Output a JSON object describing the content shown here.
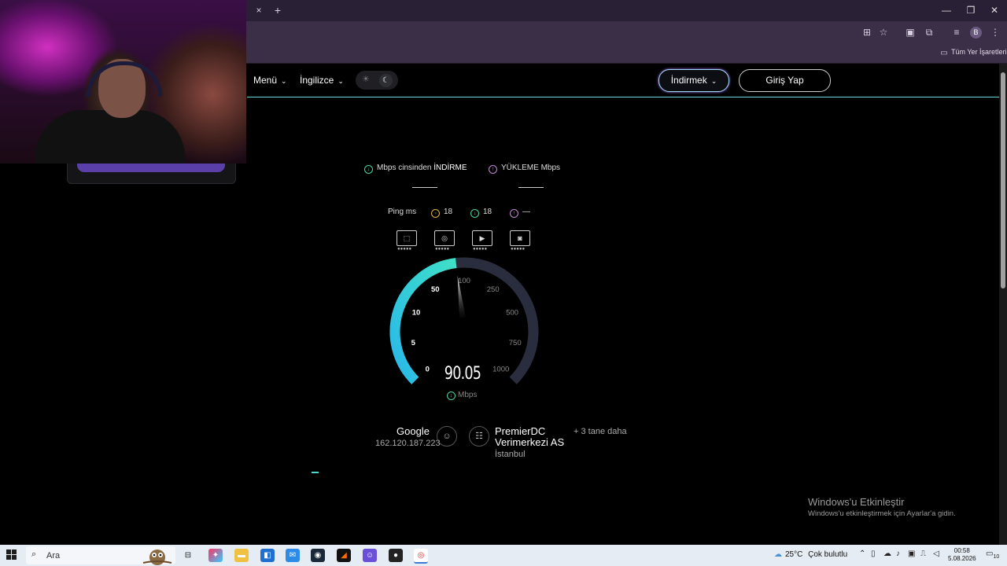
{
  "browser": {
    "tab_close": "×",
    "tab_new": "+",
    "window_controls": {
      "minimize": "—",
      "restore": "❐",
      "close": "✕"
    },
    "profile_initial": "B",
    "bookmarks_label": "Tüm Yer İşaretleri",
    "toolbar_icons": [
      "translate-icon",
      "star-icon",
      "apps-icon",
      "extensions-icon",
      "media-icon",
      "profile-icon",
      "more-icon"
    ]
  },
  "site": {
    "nav": {
      "menu_label": "Menü",
      "language_label": "İngilizce"
    },
    "download_label": "İndirmek",
    "login_label": "Giriş Yap",
    "accent_color": "#6ed6d6"
  },
  "speedtest": {
    "tabs": {
      "download_prefix": "Mbps cinsinden ",
      "download_strong": "İNDİRME",
      "upload_label": "YÜKLEME Mbps"
    },
    "ping": {
      "label": "Ping ms",
      "idle": "18",
      "download": "18",
      "upload": "—"
    },
    "gauge": {
      "ticks": [
        "0",
        "5",
        "10",
        "50",
        "100",
        "250",
        "500",
        "750",
        "1000"
      ],
      "current_value": "90.05",
      "current_numeric": 90.05,
      "unit": "Mbps",
      "fill_color_start": "#3fe0c8",
      "fill_color_end": "#2ab8e8",
      "track_color": "#2a2d3e"
    },
    "server": {
      "isp_name": "Google",
      "isp_ip": "162.120.187.223",
      "host_name_line1": "PremierDC",
      "host_name_line2": "Verimerkezi AS",
      "host_city": "İstanbul",
      "more_label": "+ 3 tane daha"
    }
  },
  "watermark": {
    "title": "Windows'u Etkinleştir",
    "subtitle": "Windows'u etkinleştirmek için Ayarlar'a gidin."
  },
  "taskbar": {
    "search_placeholder": "Ara",
    "weather_temp": "25°C",
    "weather_desc": "Çok bulutlu",
    "time": "00:58",
    "date": "5.08.2026",
    "notif_count": "10"
  }
}
